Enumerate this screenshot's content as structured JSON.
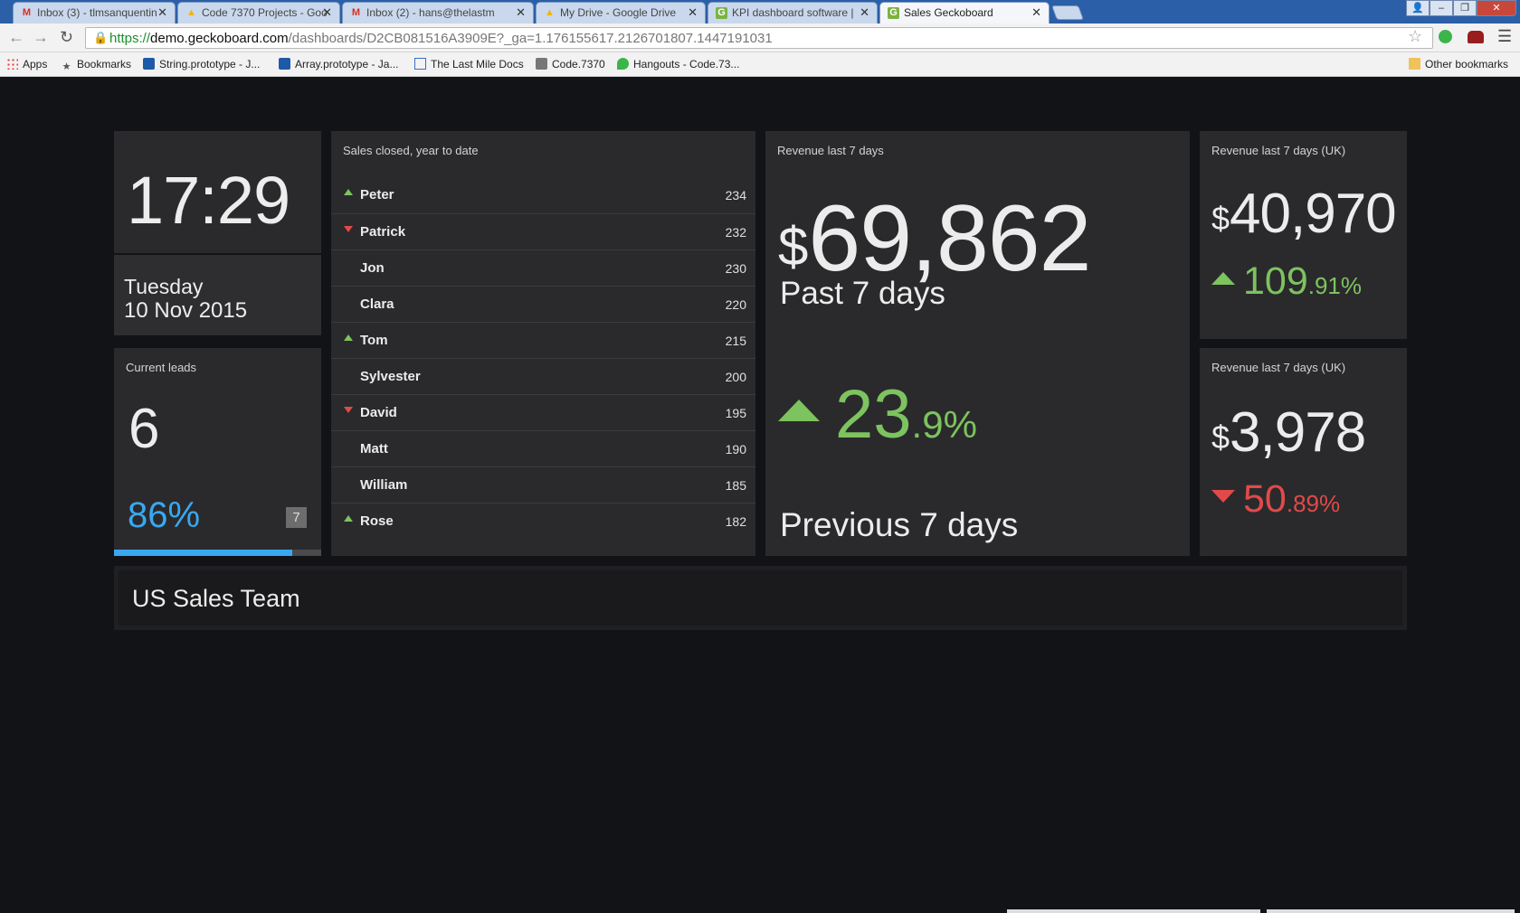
{
  "browser": {
    "tabs": [
      {
        "title": "Inbox (3) - tlmsanquentin",
        "icon": "gmail-icon"
      },
      {
        "title": "Code 7370 Projects - Goo",
        "icon": "drive-icon"
      },
      {
        "title": "Inbox (2) - hans@thelastm",
        "icon": "gmail-icon"
      },
      {
        "title": "My Drive - Google Drive",
        "icon": "drive-icon"
      },
      {
        "title": "KPI dashboard software | ",
        "icon": "geckoboard-icon"
      },
      {
        "title": "Sales Geckoboard",
        "icon": "geckoboard-icon",
        "active": true
      }
    ],
    "url": {
      "scheme": "https://",
      "host": "demo.geckoboard.com",
      "path": "/dashboards/D2CB081516A3909E?_ga=1.176155617.2126701807.1447191031"
    },
    "bookmarks": [
      {
        "label": "Apps"
      },
      {
        "label": "Bookmarks"
      },
      {
        "label": "String.prototype - J..."
      },
      {
        "label": "Array.prototype - Ja..."
      },
      {
        "label": "The Last Mile Docs"
      },
      {
        "label": "Code.7370"
      },
      {
        "label": "Hangouts - Code.73..."
      }
    ],
    "other_bookmarks": "Other bookmarks"
  },
  "clock": {
    "time": "17:29",
    "day": "Tuesday",
    "date": "10 Nov 2015"
  },
  "leads": {
    "title": "Current leads",
    "count": "6",
    "percent": "86%",
    "progress": 0.86,
    "badge": "7"
  },
  "leaderboard": {
    "title": "Sales closed, year to date",
    "rows": [
      {
        "name": "Peter",
        "value": "234",
        "trend": "up"
      },
      {
        "name": "Patrick",
        "value": "232",
        "trend": "down"
      },
      {
        "name": "Jon",
        "value": "230",
        "trend": "none"
      },
      {
        "name": "Clara",
        "value": "220",
        "trend": "none"
      },
      {
        "name": "Tom",
        "value": "215",
        "trend": "up"
      },
      {
        "name": "Sylvester",
        "value": "200",
        "trend": "none"
      },
      {
        "name": "David",
        "value": "195",
        "trend": "down"
      },
      {
        "name": "Matt",
        "value": "190",
        "trend": "none"
      },
      {
        "name": "William",
        "value": "185",
        "trend": "none"
      },
      {
        "name": "Rose",
        "value": "182",
        "trend": "up"
      }
    ]
  },
  "revenue_main": {
    "title": "Revenue last 7 days",
    "currency": "$",
    "value": "69,862",
    "period": "Past 7 days",
    "delta_int": "23",
    "delta_dec": ".9%",
    "compare": "Previous 7 days"
  },
  "revenue_uk_1": {
    "title": "Revenue last 7 days (UK)",
    "currency": "$",
    "value": "40,970",
    "delta_int": "109",
    "delta_dec": ".91%",
    "trend": "up"
  },
  "revenue_uk_2": {
    "title": "Revenue last 7 days (UK)",
    "currency": "$",
    "value": "3,978",
    "delta_int": "50",
    "delta_dec": ".89%",
    "trend": "down"
  },
  "team": {
    "name": "US Sales Team"
  },
  "colors": {
    "positive": "#7dc35f",
    "negative": "#e04a4a",
    "accent": "#39a8f1",
    "widget_bg": "#2a2a2c",
    "dashboard_bg": "#121317"
  }
}
